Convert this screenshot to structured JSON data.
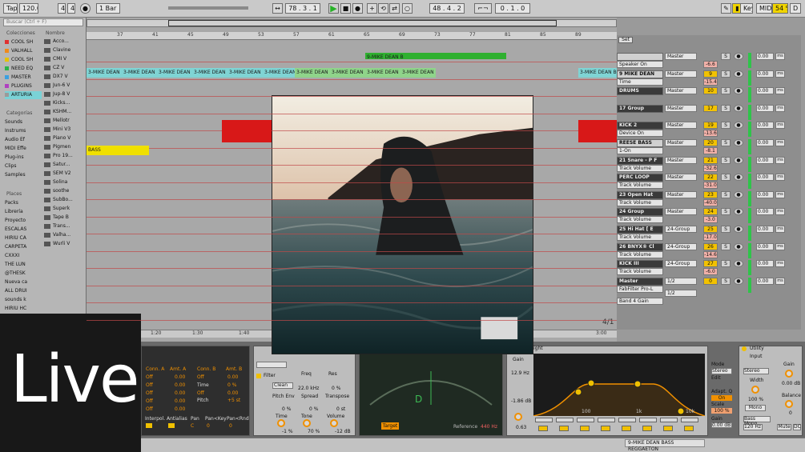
{
  "transport": {
    "tap": "Tap",
    "tempo": "120.00",
    "sig_num": "4",
    "sig_den": "4",
    "quant": "1 Bar",
    "position": "78 . 3 . 1",
    "loop_start": "48 . 4 . 2",
    "loop_len": "0 . 1 . 0",
    "key": "Key",
    "midi": "MIDI",
    "cpu": "54 %",
    "letter_d": "D"
  },
  "browser": {
    "search_placeholder": "Buscar (Ctrl + F)",
    "col_header": "Colecciones",
    "name_header": "Nombre",
    "collections": [
      {
        "label": "COOL SH",
        "color": "#e03030"
      },
      {
        "label": "VALHALL",
        "color": "#f08a1a"
      },
      {
        "label": "COOL SH",
        "color": "#e6c200"
      },
      {
        "label": "NEED EQ",
        "color": "#2bb34a"
      },
      {
        "label": "MASTER",
        "color": "#3aa0e0"
      },
      {
        "label": "PLUGINS",
        "color": "#b040c0"
      },
      {
        "label": "ARTURIA",
        "color": "#9a9a9a"
      }
    ],
    "categories_header": "Categorías",
    "categories": [
      "Sounds",
      "Instrums",
      "Audio Ef",
      "MIDI Effe",
      "Plug-ins",
      "Clips",
      "Samples"
    ],
    "places_header": "Places",
    "places": [
      "Packs",
      "Librería",
      "Proyecto",
      "ESCALAS",
      "HIRIU CA",
      "CARPETA",
      "CXXXI",
      "THE LUN",
      "@THESK",
      "Nueva ca",
      "ALL DRUI",
      "sounds k",
      "HIRIU HC"
    ],
    "items": [
      "Acco...",
      "Clavine",
      "CMI V",
      "CZ V",
      "DX7 V",
      "Jun-6 V",
      "Jup-8 V",
      "Kicks...",
      "KSHM...",
      "Mellotr",
      "Mini V3",
      "Piano V",
      "Pigmen",
      "Pro 19...",
      "Satur...",
      "SEM V2",
      "Solina",
      "soothe",
      "SubBo...",
      "Superk",
      "Tape B",
      "Trans...",
      "Valha...",
      "Wurli V"
    ]
  },
  "ruler": {
    "bars": [
      "37",
      "41",
      "45",
      "49",
      "53",
      "57",
      "61",
      "65",
      "69",
      "73",
      "77",
      "81",
      "85",
      "89"
    ],
    "times": [
      "1:20",
      "1:30",
      "1:40",
      "3:00"
    ]
  },
  "clips": {
    "mike": "3-MIKE DEAN B",
    "green": "9-MIKE DEAN B",
    "bass": "BASS"
  },
  "page_num": "4/1",
  "mixer": {
    "set": "Set",
    "tracks": [
      {
        "name": "",
        "sub": "Speaker On",
        "route": "Master",
        "num": "",
        "vol": "-6.6",
        "dark": false
      },
      {
        "name": "9 MIKE DEAN",
        "sub": "Time",
        "route": "Master",
        "num": "9",
        "vol": "-15.4",
        "dark": false
      },
      {
        "name": "DRUMS",
        "sub": "",
        "route": "Master",
        "num": "10",
        "vol": "",
        "dark": true
      },
      {
        "name": "17 Group",
        "sub": "",
        "route": "Master",
        "num": "17",
        "vol": "",
        "dark": true
      },
      {
        "name": "KICK 2",
        "sub": "Device On",
        "route": "Master",
        "num": "19",
        "vol": "-13.6",
        "dark": true
      },
      {
        "name": "REESE BASS",
        "sub": "1-On",
        "route": "Master",
        "num": "20",
        "vol": "-8.1",
        "dark": false
      },
      {
        "name": "21 Snare - P F",
        "sub": "Track Volume",
        "route": "Master",
        "num": "21",
        "vol": "-32.6",
        "dark": true
      },
      {
        "name": "PERC LOOP",
        "sub": "Track Volume",
        "route": "Master",
        "num": "22",
        "vol": "-31.0",
        "dark": true
      },
      {
        "name": "23 Open Hat",
        "sub": "Track Volume",
        "route": "Master",
        "num": "23",
        "vol": "-40.0",
        "dark": true
      },
      {
        "name": "24 Group",
        "sub": "Track Volume",
        "route": "Master",
        "num": "24",
        "vol": "-3.0",
        "dark": true
      },
      {
        "name": "25 Hi Hat [ E",
        "sub": "Track Volume",
        "route": "24-Group",
        "num": "25",
        "vol": "-17.0",
        "dark": true
      },
      {
        "name": "26 BNYX® Cl",
        "sub": "Track Volume",
        "route": "24-Group",
        "num": "26",
        "vol": "-14.6",
        "dark": true
      },
      {
        "name": "KICK III",
        "sub": "Track Volume",
        "route": "24-Group",
        "num": "27",
        "vol": "-6.0",
        "dark": true
      },
      {
        "name": "Master",
        "sub": "FabFilter Pro-L",
        "route": "1/2",
        "num": "0",
        "vol": "",
        "dark": true
      }
    ],
    "master_extra": "Band 4 Gain",
    "master_route2": "1/2",
    "send_val": "0.00",
    "ms": "ms"
  },
  "devices": {
    "instr": {
      "conn_a": "Conn. A",
      "amt_a": "Amt. A",
      "conn_b": "Conn. B",
      "amt_b": "Amt. B",
      "off": "Off",
      "zero": "0.00",
      "time": "Time",
      "time_val": "0 %",
      "pitch": "Pitch",
      "pitch_val": "+5 st",
      "interpol": "Interpol.",
      "antialias": "Antialias",
      "pan": "Pan",
      "pankey": "Pan<Key",
      "panrnd": "Pan<Rnd",
      "pan_val": "C",
      "pr_val": "0"
    },
    "sampler": {
      "filter": "Filter",
      "freq": "Freq",
      "res": "Res",
      "clean": "Clean",
      "pitch_env": "Pitch Env",
      "spread": "Spread",
      "transpose": "Transpose",
      "time": "Time",
      "tone": "Tone",
      "volume": "Volume",
      "time_val": "-1 %",
      "tone_val": "70 %",
      "vol_val": "-12 dB",
      "freq_val": "22.0 kHz",
      "res_val": "0 %",
      "pe_val": "0 %",
      "sp_val": "0 %",
      "tr_val": "0 st"
    },
    "tuner": {
      "target": "Target",
      "reference": "Reference",
      "ref_val": "440 Hz",
      "note": "D"
    },
    "eq": {
      "label": "ight",
      "gain": "Gain",
      "gain_val": "12.9 Hz",
      "freq_val": "-1.86 dB",
      "q": "0.63",
      "f100": "100",
      "f1k": "1k",
      "f10k": "10k"
    },
    "eqctl": {
      "mode": "Mode",
      "stereo": "Stereo",
      "edit": "Edit",
      "adapt": "Adapt. Q",
      "on": "On",
      "scale": "Scale",
      "scale_val": "100 %",
      "gain": "Gain",
      "gain_val": "0.00 dB"
    },
    "utility": {
      "title": "Utility",
      "input": "Input",
      "gain": "Gain",
      "gain_val": "0.00 dB",
      "stereo": "Stereo",
      "width": "Width",
      "width_val": "100 %",
      "mono": "Mono",
      "balance": "Balance",
      "bal_val": "0",
      "bass_mono": "Bass Mono",
      "bm_val": "120 Hz",
      "mute": "Mute",
      "dc": "DC"
    }
  },
  "status": {
    "track": "9-MIKE DEAN BASS REGGAETON"
  },
  "overlay": {
    "live": "Live"
  }
}
